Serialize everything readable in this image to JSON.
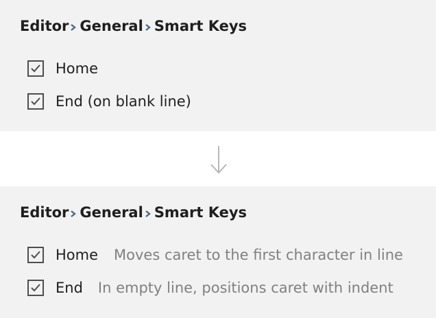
{
  "before": {
    "breadcrumb": [
      "Editor",
      "General",
      "Smart Keys"
    ],
    "options": [
      {
        "label": "Home",
        "checked": true
      },
      {
        "label": "End (on blank line)",
        "checked": true
      }
    ]
  },
  "after": {
    "breadcrumb": [
      "Editor",
      "General",
      "Smart Keys"
    ],
    "options": [
      {
        "label": "Home",
        "description": "Moves caret to the first character in line",
        "checked": true
      },
      {
        "label": "End",
        "description": "In empty line, positions caret with indent",
        "checked": true
      }
    ]
  },
  "icons": {
    "breadcrumb_separator": "chevron-right-icon",
    "transition": "arrow-down-icon",
    "checkbox_mark": "checkmark-icon"
  },
  "colors": {
    "panel_background": "#f2f2f2",
    "separator_chevron": "#4a6a8a",
    "description_text": "#808080",
    "arrow": "#b8b8b8"
  }
}
